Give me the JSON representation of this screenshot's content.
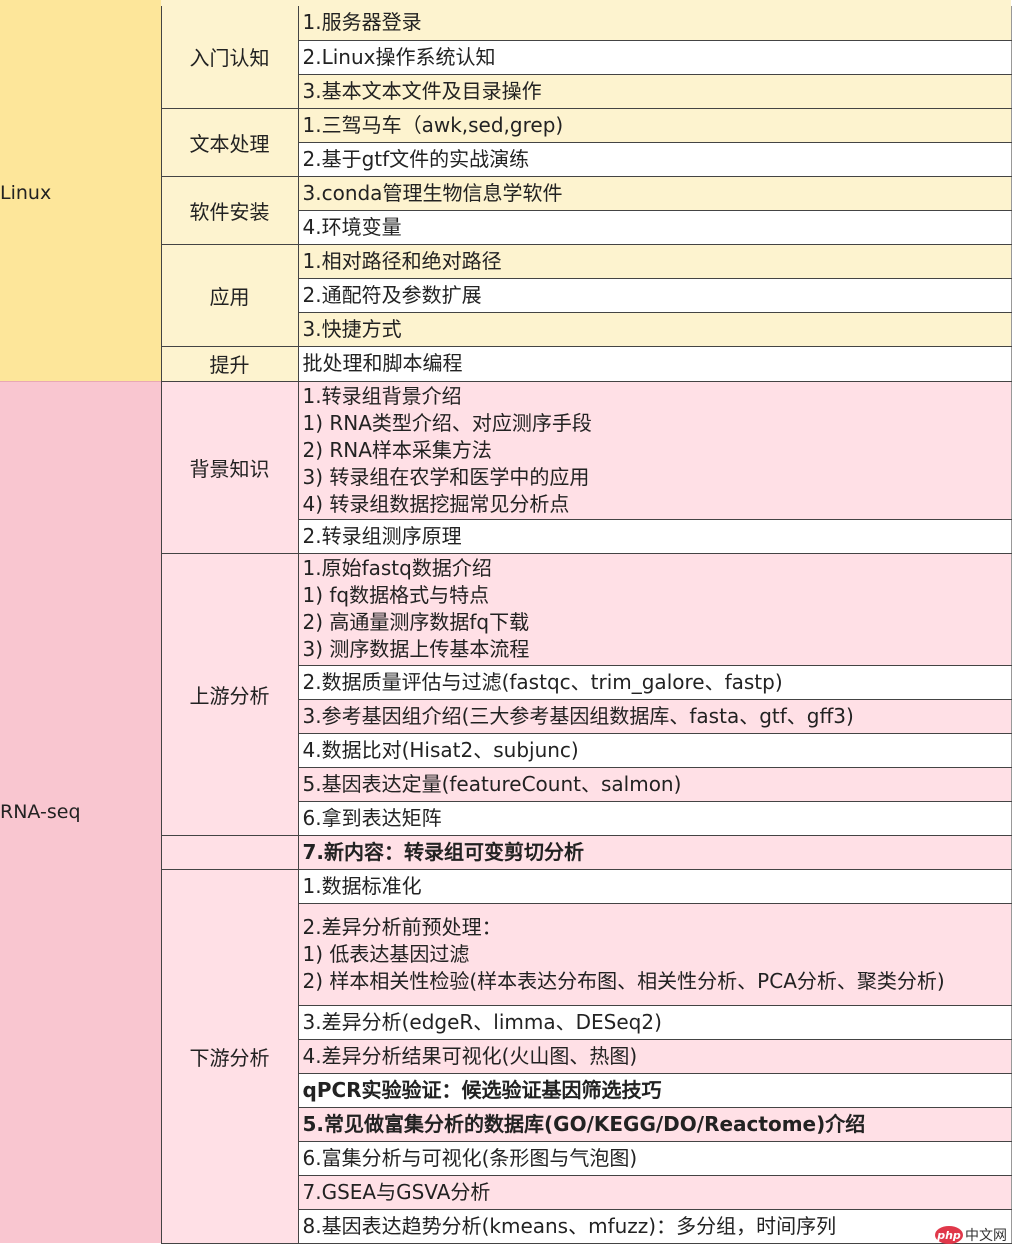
{
  "modules": {
    "linux": "Linux",
    "rnaseq": "RNA-seq"
  },
  "sections": {
    "intro": "入门认知",
    "text": "文本处理",
    "install": "软件安装",
    "apply": "应用",
    "improve": "提升",
    "background": "背景知识",
    "upstream": "上游分析",
    "downstream": "下游分析"
  },
  "items": {
    "intro_1": "1.服务器登录",
    "intro_2": "2.Linux操作系统认知",
    "intro_3": "3.基本文本文件及目录操作",
    "text_1": "1.三驾马车（awk,sed,grep)",
    "text_2": "2.基于gtf文件的实战演练",
    "install_3": "3.conda管理生物信息学软件",
    "install_4": "4.环境变量",
    "apply_1": "1.相对路径和绝对路径",
    "apply_2": "2.通配符及参数扩展",
    "apply_3": "3.快捷方式",
    "improve_1": "批处理和脚本编程",
    "bg_1_title": "1.转录组背景介绍",
    "bg_1_a": "1) RNA类型介绍、对应测序手段",
    "bg_1_b": "2) RNA样本采集方法",
    "bg_1_c": "3) 转录组在农学和医学中的应用",
    "bg_1_d": "4) 转录组数据挖掘常见分析点",
    "bg_2": "2.转录组测序原理",
    "up_1_title": "1.原始fastq数据介绍",
    "up_1_a": "1) fq数据格式与特点",
    "up_1_b": "2) 高通量测序数据fq下载",
    "up_1_c": "3) 测序数据上传基本流程",
    "up_2": "2.数据质量评估与过滤(fastqc、trim_galore、fastp)",
    "up_3": "3.参考基因组介绍(三大参考基因组数据库、fasta、gtf、gff3)",
    "up_4": "4.数据比对(Hisat2、subjunc)",
    "up_5": "5.基因表达定量(featureCount、salmon)",
    "up_6": "6.拿到表达矩阵",
    "new_7": "7.新内容：转录组可变剪切分析",
    "down_1": "1.数据标准化",
    "down_2_title": "2.差异分析前预处理：",
    "down_2_a": "1) 低表达基因过滤",
    "down_2_b": "2) 样本相关性检验(样本表达分布图、相关性分析、PCA分析、聚类分析)",
    "down_3": "3.差异分析(edgeR、limma、DESeq2)",
    "down_4": "4.差异分析结果可视化(火山图、热图)",
    "down_qpcr": "qPCR实验验证：候选验证基因筛选技巧",
    "down_5": "5.常见做富集分析的数据库(GO/KEGG/DO/Reactome)介绍",
    "down_6": "6.富集分析与可视化(条形图与气泡图)",
    "down_7": "7.GSEA与GSVA分析",
    "down_8": "8.基因表达趋势分析(kmeans、mfuzz)：多分组，时间序列"
  },
  "watermark": {
    "badge": "php",
    "text": "中文网"
  }
}
